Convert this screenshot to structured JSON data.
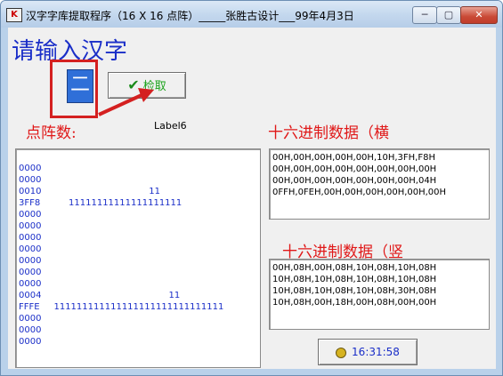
{
  "window": {
    "title": "汉字字库提取程序（16 X 16 点阵）_____张胜古设计___99年4月3日",
    "app_icon_glyph": "K",
    "controls": {
      "minimize": "─",
      "maximize": "▢",
      "close": "✕"
    }
  },
  "main": {
    "heading": "请输入汉字",
    "input_char": "二",
    "check_button_label": "检取",
    "dot_label": "点阵数:",
    "label6": "Label6",
    "hex_h_label": "十六进制数据（横",
    "hex_v_label": "十六进制数据（竖",
    "dot_rows": [
      "0000",
      "0000",
      "0010                                      11",
      "3FF8          11111111111111111111",
      "0000",
      "0000",
      "0000",
      "0000",
      "0000",
      "0000",
      "0000",
      "0004                                             11",
      "FFFE     111111111111111111111111111111",
      "0000",
      "0000",
      "0000"
    ],
    "hex_h": [
      "00H,00H,00H,00H,00H,10H,3FH,F8H",
      "00H,00H,00H,00H,00H,00H,00H,00H",
      "00H,00H,00H,00H,00H,00H,00H,04H",
      "0FFH,0FEH,00H,00H,00H,00H,00H,00H"
    ],
    "hex_v": [
      "00H,08H,00H,08H,10H,08H,10H,08H",
      "10H,08H,10H,08H,10H,08H,10H,08H",
      "10H,08H,10H,08H,10H,08H,30H,08H",
      "10H,08H,00H,18H,00H,08H,00H,00H"
    ],
    "time": "16:31:58"
  },
  "colors": {
    "accent_blue": "#1a2ec8",
    "annotation_red": "#d42020",
    "check_green": "#1aa21a"
  }
}
